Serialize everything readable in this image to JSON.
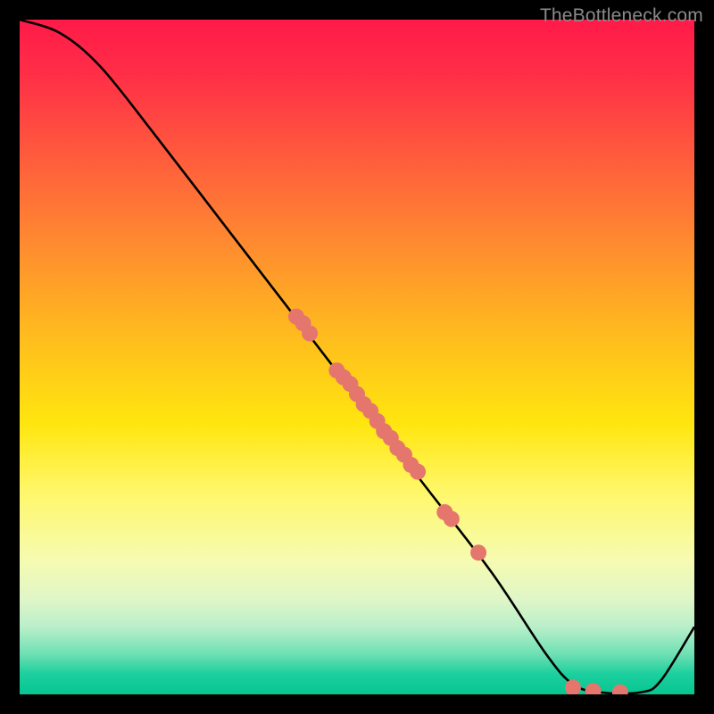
{
  "watermark": "TheBottleneck.com",
  "chart_data": {
    "type": "line",
    "title": "",
    "xlabel": "",
    "ylabel": "",
    "xlim": [
      0,
      100
    ],
    "ylim": [
      0,
      100
    ],
    "curve": [
      {
        "x": 0,
        "y": 100
      },
      {
        "x": 6,
        "y": 98
      },
      {
        "x": 12,
        "y": 93
      },
      {
        "x": 20,
        "y": 83
      },
      {
        "x": 30,
        "y": 70
      },
      {
        "x": 40,
        "y": 57
      },
      {
        "x": 50,
        "y": 44
      },
      {
        "x": 60,
        "y": 31
      },
      {
        "x": 70,
        "y": 18
      },
      {
        "x": 78,
        "y": 6
      },
      {
        "x": 82,
        "y": 1.5
      },
      {
        "x": 86,
        "y": 0.3
      },
      {
        "x": 92,
        "y": 0.3
      },
      {
        "x": 95,
        "y": 2
      },
      {
        "x": 100,
        "y": 10
      }
    ],
    "points": [
      {
        "x": 41,
        "y": 56
      },
      {
        "x": 42,
        "y": 55
      },
      {
        "x": 43,
        "y": 53.5
      },
      {
        "x": 47,
        "y": 48
      },
      {
        "x": 48,
        "y": 47
      },
      {
        "x": 49,
        "y": 46
      },
      {
        "x": 50,
        "y": 44.5
      },
      {
        "x": 51,
        "y": 43
      },
      {
        "x": 52,
        "y": 42
      },
      {
        "x": 53,
        "y": 40.5
      },
      {
        "x": 54,
        "y": 39
      },
      {
        "x": 55,
        "y": 38
      },
      {
        "x": 56,
        "y": 36.5
      },
      {
        "x": 57,
        "y": 35.5
      },
      {
        "x": 58,
        "y": 34
      },
      {
        "x": 59,
        "y": 33
      },
      {
        "x": 63,
        "y": 27
      },
      {
        "x": 64,
        "y": 26
      },
      {
        "x": 68,
        "y": 21
      },
      {
        "x": 82,
        "y": 1
      },
      {
        "x": 85,
        "y": 0.5
      },
      {
        "x": 89,
        "y": 0.3
      }
    ],
    "point_color": "#e4766d",
    "point_radius": 9
  }
}
